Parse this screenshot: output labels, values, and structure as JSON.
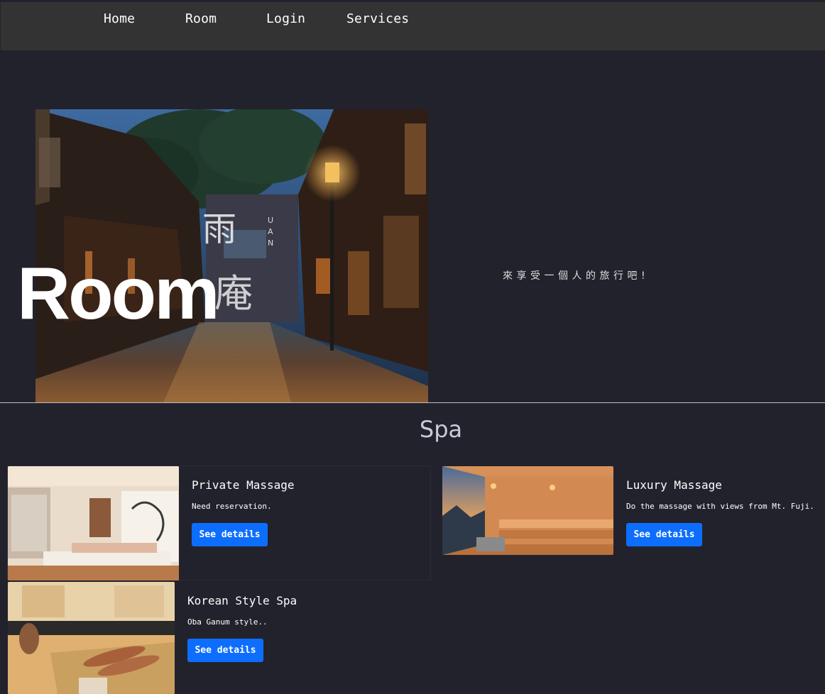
{
  "nav": {
    "items": [
      {
        "label": "Home"
      },
      {
        "label": "Room"
      },
      {
        "label": "Login"
      },
      {
        "label": "Services"
      }
    ]
  },
  "hero": {
    "title": "Room",
    "tagline": "來享受一個人的旅行吧!",
    "image_logo_chars": "雨 UAN",
    "image_description_icon": "night-street-photo"
  },
  "spa": {
    "title": "Spa",
    "cards": [
      {
        "title": "Private Massage",
        "text": "Need reservation.",
        "button": "See details"
      },
      {
        "title": "Luxury Massage",
        "text": "Do the massage with views from Mt. Fuji.",
        "button": "See details"
      },
      {
        "title": "Korean Style Spa",
        "text": "Oba Ganum style..",
        "button": "See details"
      }
    ]
  },
  "colors": {
    "background": "#22222c",
    "navbar": "#333333",
    "button": "#0d6efd"
  }
}
